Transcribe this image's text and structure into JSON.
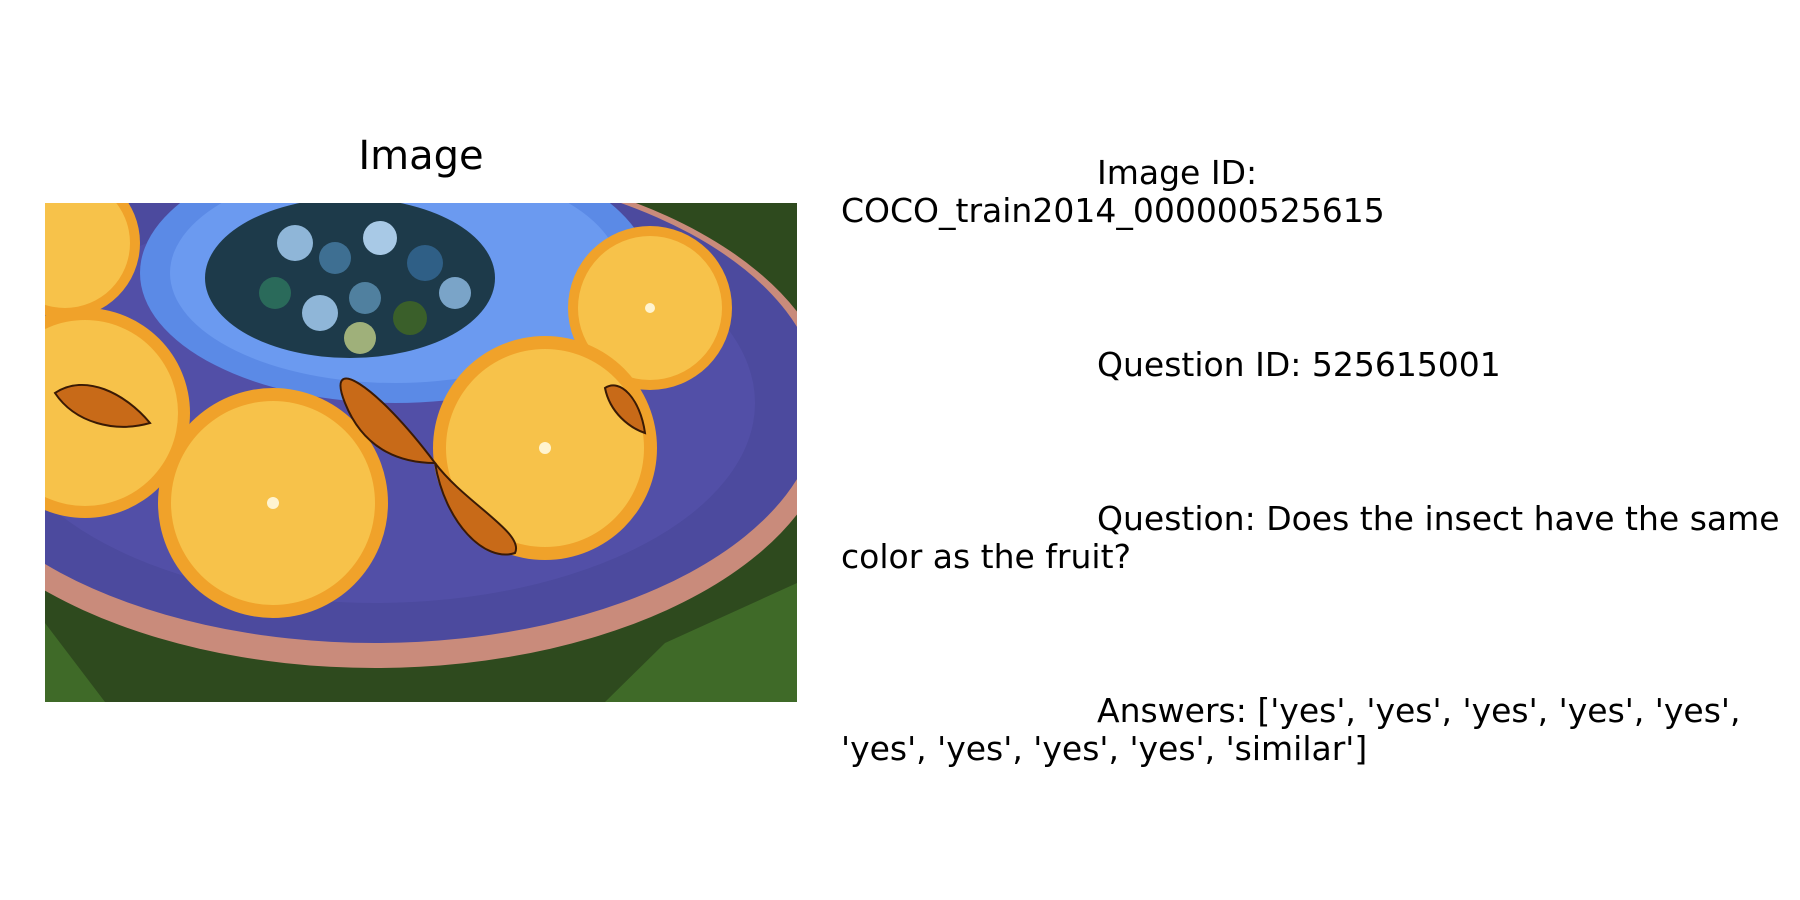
{
  "panel": {
    "title": "Image"
  },
  "photo": {
    "icon": "photo-icon",
    "palette": {
      "grass": "#2e4a1e",
      "dish": "#4c4a9e",
      "dish_rim": "#c98b7b",
      "bowl": "#5b8ae6",
      "marble_dark": "#1d3a4a",
      "marble_light": "#8fb6d8",
      "orange_peel": "#f0a22a",
      "orange_flesh": "#f7c24a",
      "butterfly": "#c86a18"
    }
  },
  "info": {
    "image_id_label": "Image ID:",
    "image_id_value": "COCO_train2014_000000525615",
    "question_id_text": "Question ID: 525615001",
    "question_first": "Question: Does the insect have the same",
    "question_rest": "color as the fruit?",
    "answers_first": "Answers: ['yes', 'yes', 'yes', 'yes', 'yes',",
    "answers_rest": "'yes', 'yes', 'yes', 'yes', 'similar']"
  }
}
